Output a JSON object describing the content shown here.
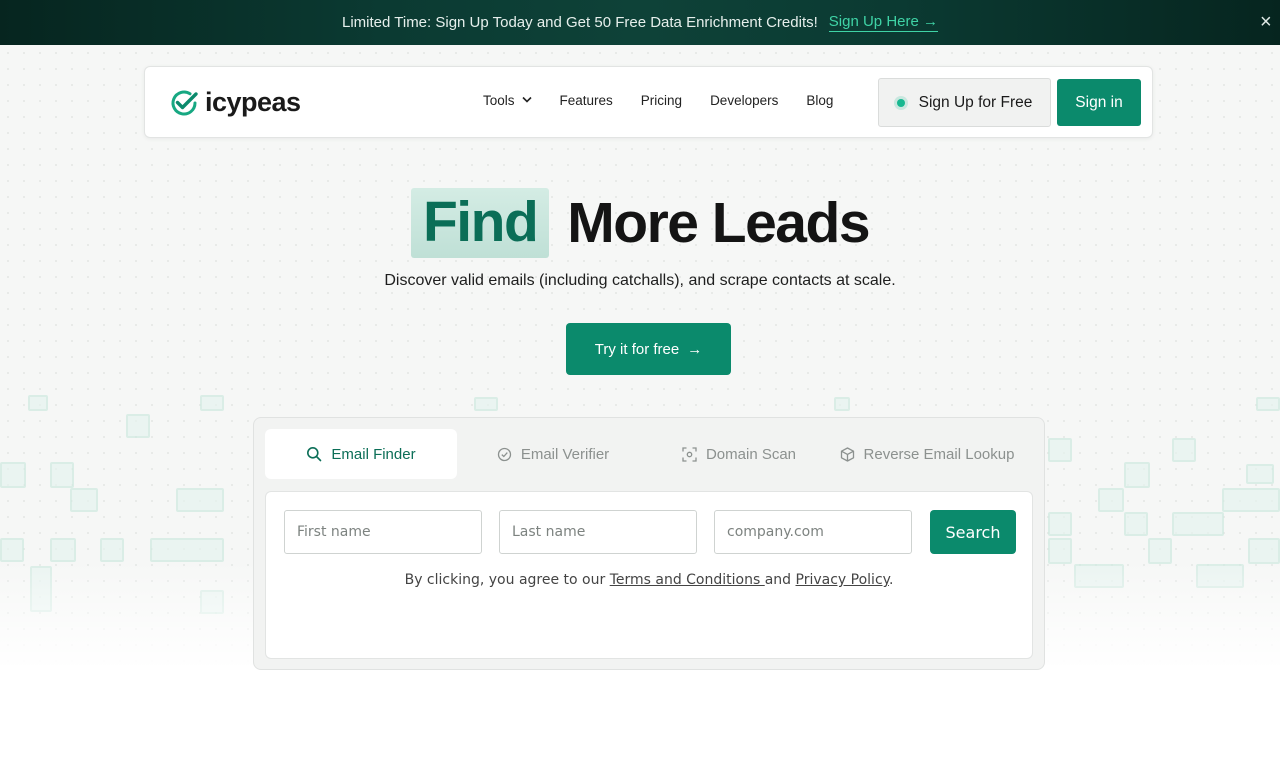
{
  "announcement": {
    "message": "Limited Time: Sign Up Today and Get 50 Free Data Enrichment Credits!",
    "cta": "Sign Up Here →",
    "close": "×"
  },
  "nav": {
    "logo_text": "icypeas",
    "links": [
      "Tools",
      "Features",
      "Pricing",
      "Developers",
      "Blog"
    ],
    "tools_chevron": "⌄",
    "signup_label": "Sign Up for Free",
    "signin_label": "Sign in"
  },
  "hero": {
    "title_highlight": "Find",
    "title_rest": "More Leads",
    "subtitle": "Discover valid emails (including catchalls), and scrape contacts at scale.",
    "cta_label": "Try it for free",
    "cta_arrow": "→"
  },
  "widget": {
    "tabs": [
      {
        "label": "Email Finder",
        "icon": "search-icon",
        "active": true
      },
      {
        "label": "Email Verifier",
        "icon": "check-circle-icon",
        "active": false
      },
      {
        "label": "Domain Scan",
        "icon": "scan-icon",
        "active": false
      },
      {
        "label": "Reverse Email Lookup",
        "icon": "cube-icon",
        "active": false
      }
    ],
    "first_name_placeholder": "First name",
    "last_name_placeholder": "Last name",
    "company_placeholder": "company.com",
    "search_label": "Search",
    "terms_prefix": "By clicking, you agree to our ",
    "terms_link": "Terms and Conditions ",
    "terms_middle": "and ",
    "privacy_link": "Privacy Policy",
    "terms_suffix": "."
  },
  "colors": {
    "brand_green": "#0b8a6c",
    "highlight_text": "#0b6e57",
    "announcement_link": "#3fd3a6"
  }
}
